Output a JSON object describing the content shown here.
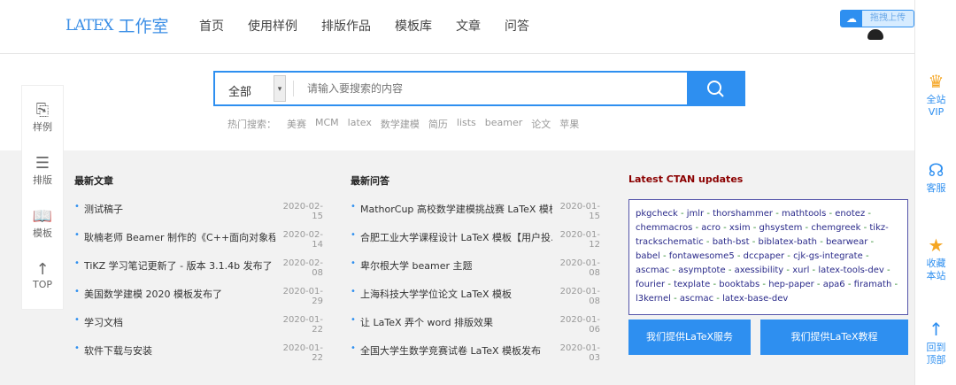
{
  "header": {
    "logo_tex": "LATEX",
    "logo_text": "工作室",
    "nav": [
      "首页",
      "使用样例",
      "排版作品",
      "模板库",
      "文章",
      "问答"
    ],
    "upload_label": "拖拽上传"
  },
  "search": {
    "category": "全部",
    "placeholder": "请输入要搜索的内容",
    "hot_label": "热门搜索：",
    "hot": [
      "美赛",
      "MCM",
      "latex",
      "数学建模",
      "简历",
      "lists",
      "beamer",
      "论文",
      "苹果"
    ]
  },
  "left_sidebar": [
    {
      "icon": "code-file-icon",
      "label": "样例"
    },
    {
      "icon": "text-align-icon",
      "label": "排版"
    },
    {
      "icon": "book-icon",
      "label": "模板"
    },
    {
      "icon": "arrow-up-icon",
      "label": "TOP"
    }
  ],
  "right_sidebar": [
    {
      "icon": "vip-icon",
      "label": "全站\nVIP"
    },
    {
      "icon": "support-icon",
      "label": "客服"
    },
    {
      "icon": "star-icon",
      "label": "收藏\n本站"
    },
    {
      "icon": "arrow-up-icon",
      "label": "回到\n顶部"
    }
  ],
  "articles": {
    "title": "最新文章",
    "items": [
      {
        "title": "测试稿子",
        "date": "2020-02-15"
      },
      {
        "title": "耿楠老师 Beamer 制作的《C++面向对象程序…",
        "date": "2020-02-14"
      },
      {
        "title": "TiKZ 学习笔记更新了 - 版本 3.1.4b 发布了",
        "date": "2020-02-08"
      },
      {
        "title": "美国数学建模 2020 模板发布了",
        "date": "2020-01-29"
      },
      {
        "title": "学习文档",
        "date": "2020-01-22"
      },
      {
        "title": "软件下载与安装",
        "date": "2020-01-22"
      }
    ]
  },
  "questions": {
    "title": "最新问答",
    "items": [
      {
        "title": "MathorCup 高校数学建模挑战赛 LaTeX 模板",
        "date": "2020-01-15"
      },
      {
        "title": "合肥工业大学课程设计 LaTeX 模板【用户投…",
        "date": "2020-01-12"
      },
      {
        "title": "卑尔根大学 beamer 主题",
        "date": "2020-01-08"
      },
      {
        "title": "上海科技大学学位论文 LaTeX 模板",
        "date": "2020-01-08"
      },
      {
        "title": "让 LaTeX 弄个 word 排版效果",
        "date": "2020-01-06"
      },
      {
        "title": "全国大学生数学竞赛试卷 LaTeX 模板发布",
        "date": "2020-01-03"
      }
    ]
  },
  "ctan": {
    "title": "Latest CTAN updates",
    "packages": [
      "pkgcheck",
      "jmlr",
      "thorshammer",
      "mathtools",
      "enotez",
      "chemmacros",
      "acro",
      "xsim",
      "ghsystem",
      "chemgreek",
      "tikz-trackschematic",
      "bath-bst",
      "biblatex-bath",
      "bearwear",
      "babel",
      "fontawesome5",
      "dccpaper",
      "cjk-gs-integrate",
      "ascmac",
      "asymptote",
      "axessibility",
      "xurl",
      "latex-tools-dev",
      "fourier",
      "texplate",
      "booktabs",
      "hep-paper",
      "apa6",
      "firamath",
      "l3kernel",
      "ascmac",
      "latex-base-dev"
    ]
  },
  "buttons": {
    "service": "我们提供LaTeX服务",
    "tutorial": "我们提供LaTeX教程"
  }
}
